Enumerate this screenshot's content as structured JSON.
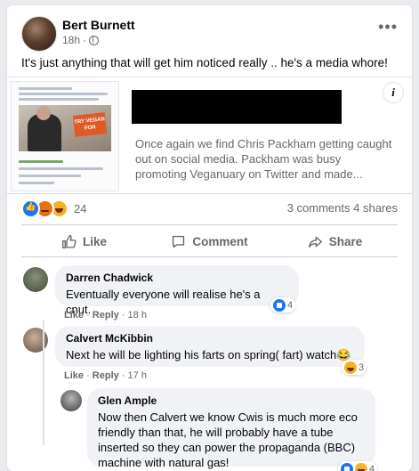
{
  "post": {
    "author": "Bert Burnett",
    "time": "18h",
    "separator": "·",
    "text": "It's just anything that will get him noticed really .. he's a media whore!"
  },
  "link_preview": {
    "sign_text": "TRY VEGAN FOR",
    "description": "Once again we find Chris Packham getting caught out on social media. Packham was busy promoting Veganuary on Twitter and made..."
  },
  "stats": {
    "reaction_count": "24",
    "comments": "3 comments",
    "shares": "4 shares"
  },
  "actions": {
    "like": "Like",
    "comment": "Comment",
    "share": "Share"
  },
  "comments": [
    {
      "name": "Darren Chadwick",
      "text": "Eventually everyone will realise he's a cnut.",
      "like_label": "Like",
      "reply_label": "Reply",
      "time": "18 h",
      "reaction_count": "4"
    },
    {
      "name": "Calvert McKibbin",
      "text": "Next he will be lighting his farts on spring( fart) watch😂",
      "like_label": "Like",
      "reply_label": "Reply",
      "time": "17 h",
      "reaction_count": "3"
    },
    {
      "name": "Glen Ample",
      "text": "Now then Calvert we know Cwis is much more eco friendly than that, he will probably have a tube inserted so they can power the propaganda (BBC) machine with natural gas!",
      "reaction_count": "4"
    }
  ],
  "colors": {
    "facebook_blue": "#1877f2",
    "secondary_text": "#65676b",
    "bubble_bg": "#f0f2f5"
  }
}
